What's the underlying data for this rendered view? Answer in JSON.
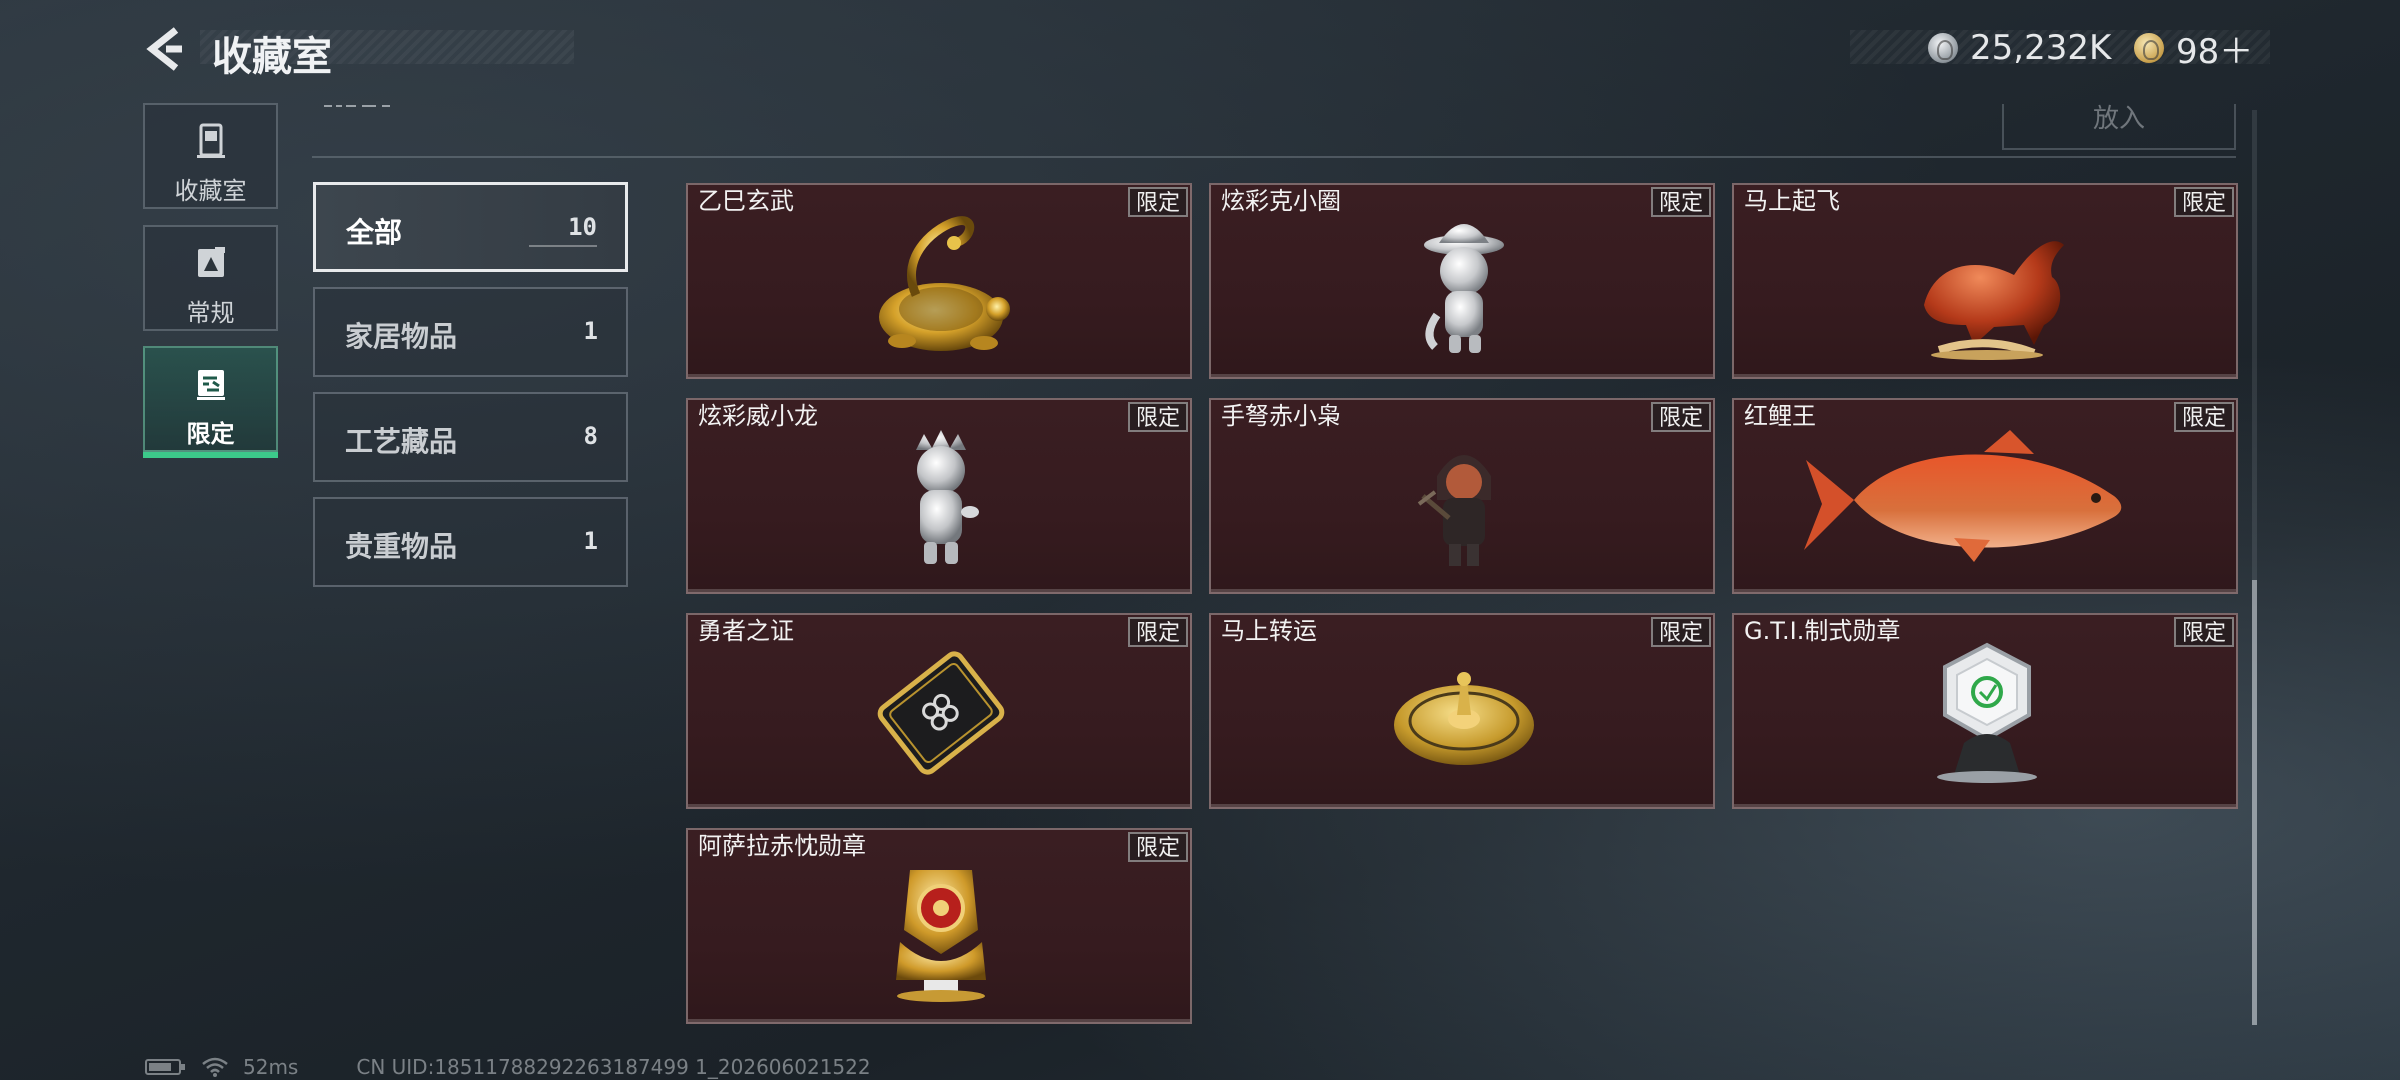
{
  "header": {
    "title": "收藏室",
    "currency": [
      {
        "icon": "silver-coin-icon",
        "value": "25,232K"
      },
      {
        "icon": "gold-coin-icon",
        "value": "98＋"
      }
    ]
  },
  "left_nav": [
    {
      "label": "收藏室",
      "icon": "collection-room-icon",
      "active": false
    },
    {
      "label": "常规",
      "icon": "regular-icon",
      "active": false
    },
    {
      "label": "限定",
      "icon": "limited-icon",
      "active": true
    }
  ],
  "top_strip": {
    "put_label": "放入"
  },
  "categories": [
    {
      "label": "全部",
      "count": "10",
      "active": true
    },
    {
      "label": "家居物品",
      "count": "1",
      "active": false
    },
    {
      "label": "工艺藏品",
      "count": "8",
      "active": false
    },
    {
      "label": "贵重物品",
      "count": "1",
      "active": false
    }
  ],
  "items": [
    {
      "name": "乙巳玄武",
      "tag": "限定",
      "art": "gold-tortoise-snake-icon"
    },
    {
      "name": "炫彩克小圈",
      "tag": "限定",
      "art": "silver-figurine-hat-icon"
    },
    {
      "name": "马上起飞",
      "tag": "限定",
      "art": "red-horse-icon"
    },
    {
      "name": "炫彩威小龙",
      "tag": "限定",
      "art": "silver-figurine-crown-icon"
    },
    {
      "name": "手弩赤小枭",
      "tag": "限定",
      "art": "hooded-figure-icon"
    },
    {
      "name": "红鲤王",
      "tag": "限定",
      "art": "red-carp-icon"
    },
    {
      "name": "勇者之证",
      "tag": "限定",
      "art": "black-gold-card-icon"
    },
    {
      "name": "马上转运",
      "tag": "限定",
      "art": "gold-disc-icon"
    },
    {
      "name": "G.T.I.制式勋章",
      "tag": "限定",
      "art": "hexagon-medal-icon"
    },
    {
      "name": "阿萨拉赤忱勋章",
      "tag": "限定",
      "art": "gold-red-medal-icon"
    }
  ],
  "status": {
    "ping": "52ms",
    "uid": "CN UID:18511788292263187499 1_202606021522"
  },
  "colors": {
    "accent": "#3cc98a",
    "card_bg": "#361b1f"
  }
}
